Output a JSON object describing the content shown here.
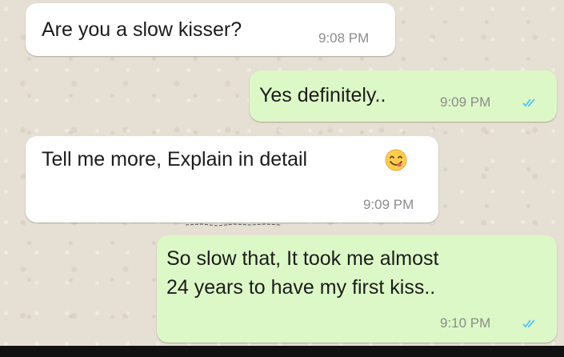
{
  "chat": {
    "messages": [
      {
        "direction": "incoming",
        "text": "Are you a slow kisser?",
        "time": "9:08 PM"
      },
      {
        "direction": "outgoing",
        "text": "Yes definitely..",
        "time": "9:09 PM",
        "status": "read"
      },
      {
        "direction": "incoming",
        "text": "Tell me more, Explain in detail",
        "time": "9:09 PM",
        "icon": "smiling-face-emoji-icon"
      },
      {
        "direction": "outgoing",
        "text_line1": "So slow that, It took me almost",
        "text_line2": "24 years to have my first kiss..",
        "time": "9:10 PM",
        "status": "read"
      }
    ]
  },
  "colors": {
    "incoming_bubble": "#ffffff",
    "outgoing_bubble": "#dcf8c6",
    "read_ticks": "#4fc3f7",
    "timestamp": "#8c8c8c",
    "wallpaper": "#e6dfd3"
  }
}
